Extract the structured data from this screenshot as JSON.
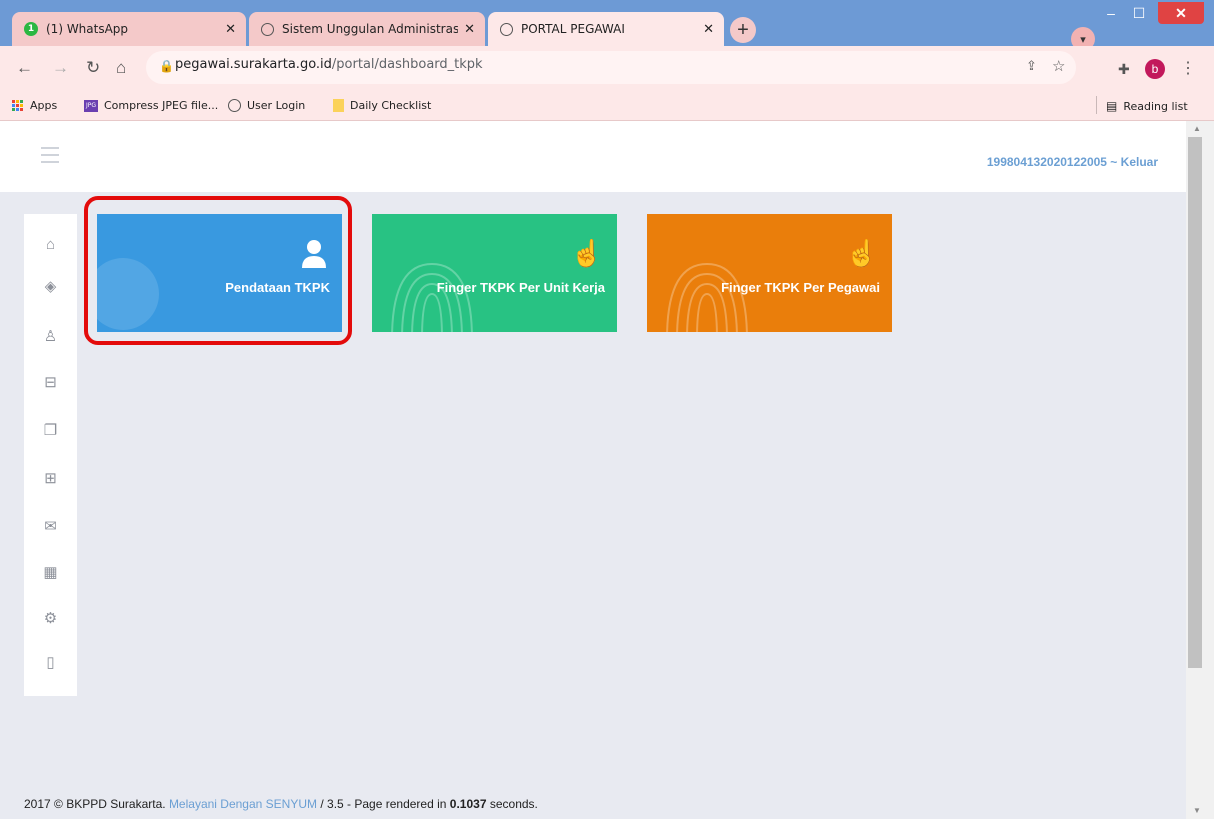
{
  "browser": {
    "tabs": [
      {
        "title": "(1) WhatsApp",
        "badge": "1"
      },
      {
        "title": "Sistem Unggulan Administrasi Ke"
      },
      {
        "title": "PORTAL PEGAWAI"
      }
    ],
    "address": {
      "host": "pegawai.surakarta.go.id",
      "path": "/portal/dashboard_tkpk"
    },
    "profile_initial": "b",
    "bookmarks": [
      "Apps",
      "Compress JPEG file...",
      "User Login",
      "Daily Checklist"
    ],
    "bookmark_jpg_badge": "JPG",
    "reading_list": "Reading list"
  },
  "header": {
    "user_link": "199804132020122005 ~ Keluar"
  },
  "sidebar": {
    "icons": [
      "home-icon",
      "layers-icon",
      "user-icon",
      "briefcase-icon",
      "documents-icon",
      "grid-icon",
      "mail-icon",
      "book-icon",
      "settings-icon",
      "notebook-icon"
    ]
  },
  "cards": [
    {
      "label": "Pendataan TKPK",
      "color": "#3999e0",
      "icon": "user-icon"
    },
    {
      "label": "Finger TKPK Per Unit Kerja",
      "color": "#28c283",
      "icon": "hand-pointer-icon"
    },
    {
      "label": "Finger TKPK Per Pegawai",
      "color": "#ea7e0b",
      "icon": "hand-pointer-icon"
    }
  ],
  "footer": {
    "prefix": "2017 © BKPPD Surakarta.",
    "link": "Melayani Dengan SENYUM",
    "middle": "/ 3.5 - Page rendered in",
    "time": "0.1037",
    "suffix": "seconds."
  }
}
